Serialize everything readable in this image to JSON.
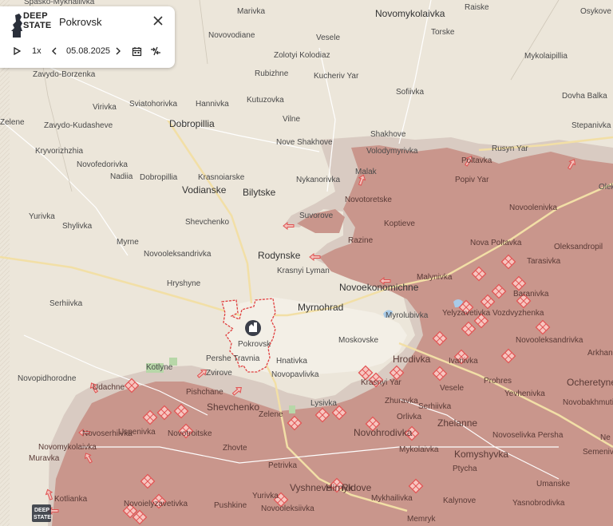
{
  "panel": {
    "brand_line1": "DEEP",
    "brand_line2": "STATE",
    "title": "Pokrovsk",
    "speed": "1x",
    "date": "05.08.2025"
  },
  "icons": [
    "logo-icon",
    "close-icon",
    "play-icon",
    "chevron-left-icon",
    "chevron-right-icon",
    "calendar-icon",
    "collapse-icon",
    "city-marker-icon",
    "attack-arrow-icon",
    "combat-marker-icon"
  ],
  "colors": {
    "land": "#ece6da",
    "occupied": "#c9968c",
    "occupied_border": "#d9c5bc",
    "contested_outline": "#e04040",
    "road_main": "#f2dfa6",
    "road_minor": "#ffffff",
    "green": "#b7d7a8",
    "water": "#a9cbe8",
    "marker": "#e85a5a"
  },
  "places": {
    "spasko": "Spasko-Mykhailivka",
    "marivka": "Marivka",
    "novomykolaivka_n": "Novomykolaivka",
    "raiske": "Raiske",
    "osykove": "Osykove",
    "novovodiane": "Novovodiane",
    "vesele_n": "Vesele",
    "torske": "Torske",
    "zolotyi": "Zolotyi Kolodiaz",
    "mykolaipillia": "Mykolaipillia",
    "zavydo_borzenka": "Zavydo-Borzenka",
    "rubizhne": "Rubizhne",
    "kucheriv": "Kucheriv Yar",
    "sofiivka": "Sofiivka",
    "dovha_balka": "Dovha Balka",
    "virivka": "Virivka",
    "sviatohorivka": "Sviatohorivka",
    "hannivka": "Hannivka",
    "kutuzovka": "Kutuzovka",
    "zelene_w": "Zelene",
    "zavydo_kudasheve": "Zavydo-Kudasheve",
    "dobropillia": "Dobropillia",
    "vilne": "Vilne",
    "stepanivka": "Stepanivka",
    "shakhove": "Shakhove",
    "nove_shakhove": "Nove Shakhove",
    "kryvorizhzhia": "Kryvorizhzhia",
    "volodymyrivka": "Volodymyrivka",
    "rusyn_yar": "Rusyn Yar",
    "novofedorivka": "Novofedorivka",
    "poltavka": "Poltavka",
    "malak": "Malak",
    "nadiia": "Nadiia",
    "dobropillia2": "Dobropillia",
    "krasnoiarske": "Krasnoiarske",
    "nykanorivka": "Nykanorivka",
    "popiv_yar": "Popiv Yar",
    "vodianske": "Vodianske",
    "bilytske": "Bilytske",
    "novotoretske": "Novotoretske",
    "novoolenivka": "Novoolenivka",
    "yurivka_w": "Yurivka",
    "shevchenko_n": "Shevchenko",
    "suvorove": "Suvorove",
    "koptieve": "Koptieve",
    "shylivka": "Shylivka",
    "myrne": "Myrne",
    "razine": "Razine",
    "nova_poltavka": "Nova Poltavka",
    "oleksandropil": "Oleksandropil",
    "novooleksandrivka_n": "Novooleksandrivka",
    "rodynske": "Rodynske",
    "tarasivka": "Tarasivka",
    "krasnyi_lyman": "Krasnyi Lyman",
    "malynivka": "Malynivka",
    "hryshyne": "Hryshyne",
    "novoekonomichne": "Novoekonomichne",
    "baranivka": "Baranivka",
    "serhiivka_w": "Serhiivka",
    "myrnohrad": "Myrnohrad",
    "yelyzavetivka": "Yelyzavetivka",
    "vozdvyzhenka": "Vozdvyzhenka",
    "myrolubivka": "Myrolubivka",
    "novooleksandrivka_e": "Novooleksandrivka",
    "pokrovsk": "Pokrovsk",
    "moskovske": "Moskovske",
    "arkhan": "Arkhan",
    "novopidhorodne": "Novopidhorodne",
    "pershe_travnia": "Pershe Travnia",
    "hnativka": "Hnativka",
    "hrodivka": "Hrodivka",
    "ivanivka": "Ivanivka",
    "kotlyne": "Kotlyne",
    "novopavlivka": "Novopavlivka",
    "prohres": "Prohres",
    "ocheretyne": "Ocheretyne",
    "udachne": "Udachne",
    "zvirove": "Zvirove",
    "krasnyi_yar": "Krasnyi Yar",
    "vesele_s": "Vesele",
    "yevhenivka": "Yevhenivka",
    "pishchane": "Pishchane",
    "zhuravka": "Zhuravka",
    "serhiivka_s": "Serhiivka",
    "novobakhmutivka": "Novobakhmutivka",
    "shevchenko_s": "Shevchenko",
    "lysivka": "Lysivka",
    "orlivka": "Orlivka",
    "zelene_s": "Zelene",
    "novoserhiivka": "Novoserhiivka",
    "uspenivka": "Uspenivka",
    "novotroitske": "Novotroitske",
    "novohrodivka": "Novohrodivka",
    "zhelanne": "Zhelanne",
    "novoselivka_persha": "Novoselivka Persha",
    "novomykolaivka_s": "Novomykolaivka",
    "zhovte": "Zhovte",
    "mykolaivka": "Mykolaivka",
    "komyshyvka": "Komyshyvka",
    "semenivka": "Semenivka",
    "muravka": "Muravka",
    "petrivka": "Petrivka",
    "ptycha": "Ptycha",
    "vyshneve": "Vyshneve",
    "hirnyk": "Hirnyk",
    "ridove": "Ridove",
    "umanske": "Umanske",
    "kotlianka": "Kotlianka",
    "yurivka_s": "Yurivka",
    "mykhailivka": "Mykhailivka",
    "kalynove": "Kalynove",
    "novoielyzavetivka": "Novoielyzavetivka",
    "pushkine": "Pushkine",
    "novooleksiivka": "Novooleksiivka",
    "yasnobrodivka": "Yasnobrodivka",
    "memryk": "Memryk"
  }
}
